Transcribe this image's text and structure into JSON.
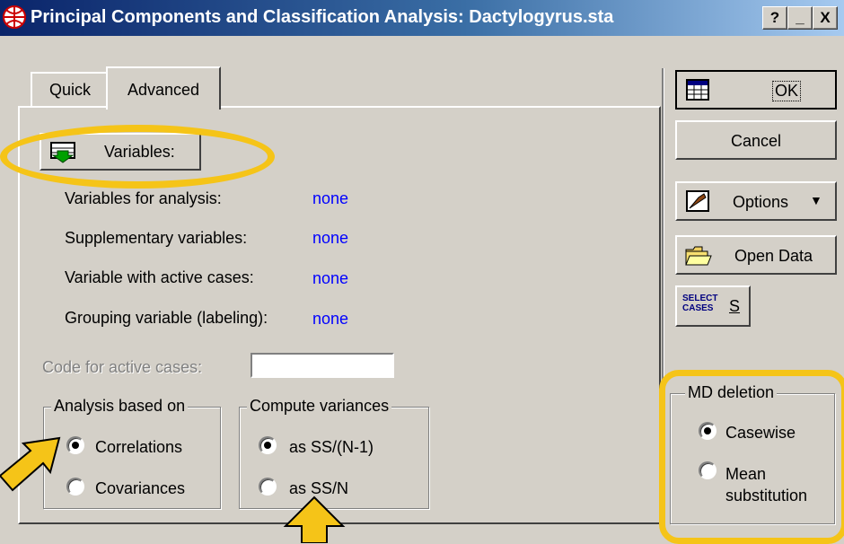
{
  "window": {
    "title": "Principal Components and Classification Analysis: Dactylogyrus.sta",
    "help_label": "?",
    "minimize_label": "_",
    "close_label": "X"
  },
  "tabs": [
    {
      "label": "Quick",
      "active": false
    },
    {
      "label": "Advanced",
      "active": true
    }
  ],
  "variables_button": {
    "label": "Variables:",
    "icon": "variables-icon"
  },
  "fields": [
    {
      "label": "Variables for analysis:",
      "value": "none"
    },
    {
      "label": "Supplementary variables:",
      "value": "none"
    },
    {
      "label": "Variable with active cases:",
      "value": "none"
    },
    {
      "label": "Grouping variable (labeling):",
      "value": "none"
    }
  ],
  "code_active_cases": {
    "label": "Code for active cases:",
    "value": ""
  },
  "analysis_based_on": {
    "title": "Analysis based on",
    "options": [
      {
        "label": "Correlations",
        "selected": true
      },
      {
        "label": "Covariances",
        "selected": false
      }
    ]
  },
  "compute_variances": {
    "title": "Compute variances",
    "options": [
      {
        "label": "as SS/(N-1)",
        "selected": true
      },
      {
        "label": "as SS/N",
        "selected": false
      }
    ]
  },
  "side_buttons": {
    "ok": "OK",
    "cancel": "Cancel",
    "options": "Options",
    "open_data": "Open Data",
    "select_cases_icon_text": "SELECT CASES",
    "select_cases_s": "S"
  },
  "md_deletion": {
    "title": "MD deletion",
    "options": [
      {
        "label": "Casewise",
        "selected": true
      },
      {
        "label": "Mean substitution",
        "selected": false
      }
    ]
  },
  "colors": {
    "highlight": "#f5c418",
    "value_text": "#0000ff",
    "title_bar": "#0a246a"
  }
}
